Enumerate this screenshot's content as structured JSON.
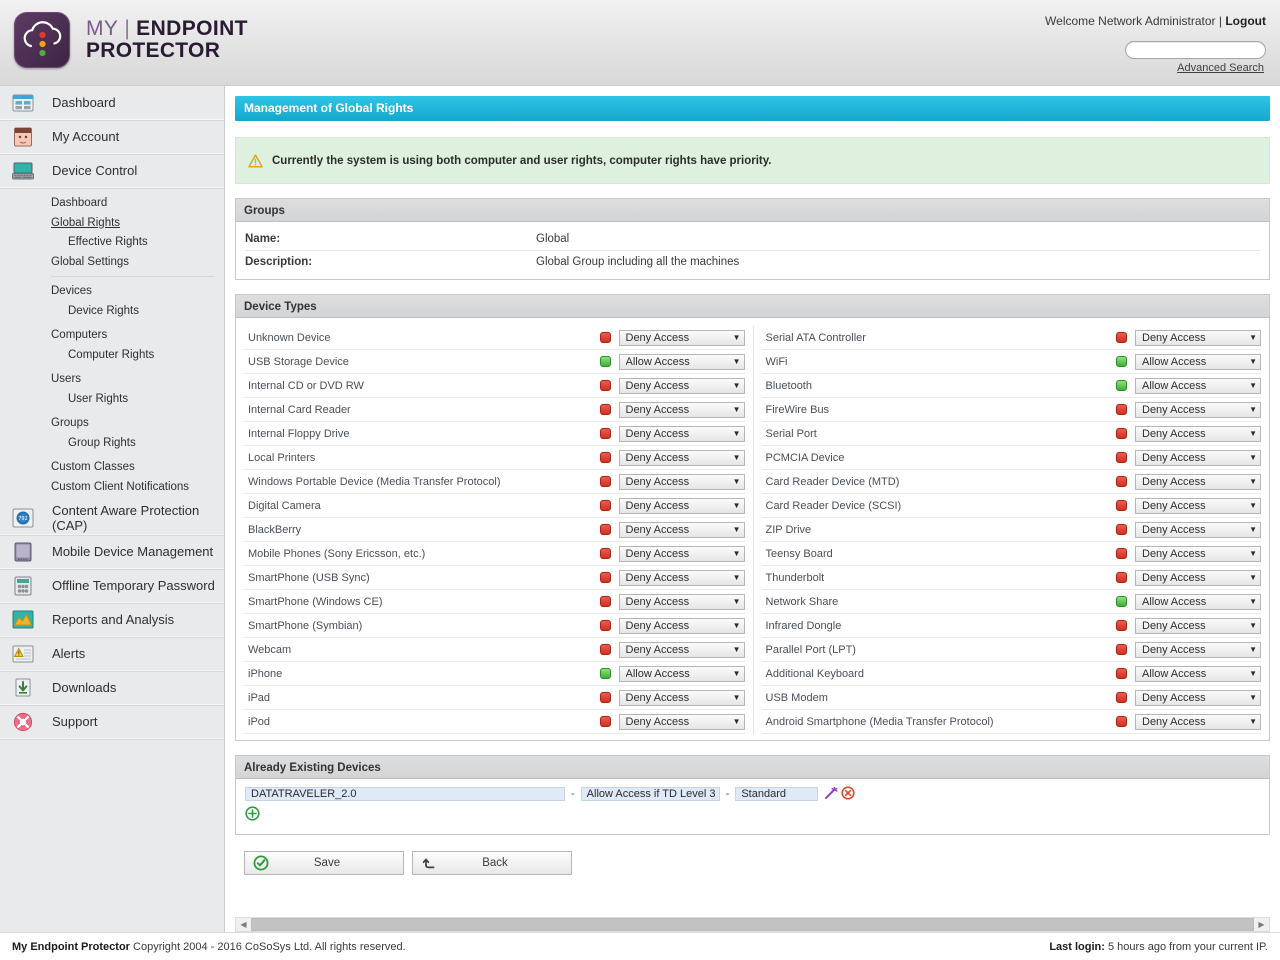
{
  "brand": {
    "my": "MY",
    "divider": "|",
    "line1": "ENDPOINT",
    "line2": "PROTECTOR",
    "logo_colors": {
      "badge": "#4b2e52",
      "red": "#e03b2e",
      "amber": "#f0a020",
      "green": "#4fae3a"
    }
  },
  "header": {
    "welcome": "Welcome Network Administrator",
    "separator": "|",
    "logout": "Logout",
    "search_placeholder": "",
    "search_value": "",
    "advanced_search": "Advanced Search"
  },
  "sidebar": {
    "items": [
      {
        "label": "Dashboard",
        "icon": "dashboard-icon"
      },
      {
        "label": "My Account",
        "icon": "user-icon"
      },
      {
        "label": "Device Control",
        "icon": "laptop-icon"
      },
      {
        "label": "Content Aware Protection (CAP)",
        "icon": "shield-icon"
      },
      {
        "label": "Mobile Device Management",
        "icon": "tablet-icon"
      },
      {
        "label": "Offline Temporary Password",
        "icon": "keypad-icon"
      },
      {
        "label": "Reports and Analysis",
        "icon": "chart-icon"
      },
      {
        "label": "Alerts",
        "icon": "alert-icon"
      },
      {
        "label": "Downloads",
        "icon": "download-icon"
      },
      {
        "label": "Support",
        "icon": "lifebuoy-icon"
      }
    ],
    "device_control_sub": [
      {
        "label": "Dashboard",
        "level": 1,
        "active": false
      },
      {
        "label": "Global Rights",
        "level": 1,
        "active": true
      },
      {
        "label": "Effective Rights",
        "level": 2,
        "active": false
      },
      {
        "label": "Global Settings",
        "level": 1,
        "active": false
      },
      {
        "label": "__SEP__",
        "level": 0,
        "active": false
      },
      {
        "label": "Devices",
        "level": 1,
        "active": false
      },
      {
        "label": "Device Rights",
        "level": 2,
        "active": false
      },
      {
        "label": "__GAP__",
        "level": 0,
        "active": false
      },
      {
        "label": "Computers",
        "level": 1,
        "active": false
      },
      {
        "label": "Computer Rights",
        "level": 2,
        "active": false
      },
      {
        "label": "__GAP__",
        "level": 0,
        "active": false
      },
      {
        "label": "Users",
        "level": 1,
        "active": false
      },
      {
        "label": "User Rights",
        "level": 2,
        "active": false
      },
      {
        "label": "__GAP__",
        "level": 0,
        "active": false
      },
      {
        "label": "Groups",
        "level": 1,
        "active": false
      },
      {
        "label": "Group Rights",
        "level": 2,
        "active": false
      },
      {
        "label": "__GAP__",
        "level": 0,
        "active": false
      },
      {
        "label": "Custom Classes",
        "level": 1,
        "active": false
      },
      {
        "label": "Custom Client Notifications",
        "level": 1,
        "active": false
      }
    ]
  },
  "page": {
    "title": "Management of Global Rights",
    "title_color": "#22b6da",
    "notice": "Currently the system is using both computer and user rights, computer rights have priority.",
    "notice_bg": "#ddf1de"
  },
  "groups_panel": {
    "heading": "Groups",
    "rows": [
      {
        "key": "Name:",
        "value": "Global"
      },
      {
        "key": "Description:",
        "value": "Global Group including all the machines"
      }
    ]
  },
  "device_types_panel": {
    "heading": "Device Types",
    "left": [
      {
        "name": "Unknown Device",
        "status": "deny",
        "right": "Deny Access"
      },
      {
        "name": "USB Storage Device",
        "status": "allow",
        "right": "Allow Access"
      },
      {
        "name": "Internal CD or DVD RW",
        "status": "deny",
        "right": "Deny Access"
      },
      {
        "name": "Internal Card Reader",
        "status": "deny",
        "right": "Deny Access"
      },
      {
        "name": "Internal Floppy Drive",
        "status": "deny",
        "right": "Deny Access"
      },
      {
        "name": "Local Printers",
        "status": "deny",
        "right": "Deny Access"
      },
      {
        "name": "Windows Portable Device (Media Transfer Protocol)",
        "status": "deny",
        "right": "Deny Access"
      },
      {
        "name": "Digital Camera",
        "status": "deny",
        "right": "Deny Access"
      },
      {
        "name": "BlackBerry",
        "status": "deny",
        "right": "Deny Access"
      },
      {
        "name": "Mobile Phones (Sony Ericsson, etc.)",
        "status": "deny",
        "right": "Deny Access"
      },
      {
        "name": "SmartPhone (USB Sync)",
        "status": "deny",
        "right": "Deny Access"
      },
      {
        "name": "SmartPhone (Windows CE)",
        "status": "deny",
        "right": "Deny Access"
      },
      {
        "name": "SmartPhone (Symbian)",
        "status": "deny",
        "right": "Deny Access"
      },
      {
        "name": "Webcam",
        "status": "deny",
        "right": "Deny Access"
      },
      {
        "name": "iPhone",
        "status": "allow",
        "right": "Allow Access"
      },
      {
        "name": "iPad",
        "status": "deny",
        "right": "Deny Access"
      },
      {
        "name": "iPod",
        "status": "deny",
        "right": "Deny Access"
      }
    ],
    "right": [
      {
        "name": "Serial ATA Controller",
        "status": "deny",
        "right": "Deny Access"
      },
      {
        "name": "WiFi",
        "status": "allow",
        "right": "Allow Access"
      },
      {
        "name": "Bluetooth",
        "status": "allow",
        "right": "Allow Access"
      },
      {
        "name": "FireWire Bus",
        "status": "deny",
        "right": "Deny Access"
      },
      {
        "name": "Serial Port",
        "status": "deny",
        "right": "Deny Access"
      },
      {
        "name": "PCMCIA Device",
        "status": "deny",
        "right": "Deny Access"
      },
      {
        "name": "Card Reader Device (MTD)",
        "status": "deny",
        "right": "Deny Access"
      },
      {
        "name": "Card Reader Device (SCSI)",
        "status": "deny",
        "right": "Deny Access"
      },
      {
        "name": "ZIP Drive",
        "status": "deny",
        "right": "Deny Access"
      },
      {
        "name": "Teensy Board",
        "status": "deny",
        "right": "Deny Access"
      },
      {
        "name": "Thunderbolt",
        "status": "deny",
        "right": "Deny Access"
      },
      {
        "name": "Network Share",
        "status": "allow",
        "right": "Allow Access"
      },
      {
        "name": "Infrared Dongle",
        "status": "deny",
        "right": "Deny Access"
      },
      {
        "name": "Parallel Port (LPT)",
        "status": "deny",
        "right": "Deny Access"
      },
      {
        "name": "Additional Keyboard",
        "status": "deny",
        "right": "Allow Access"
      },
      {
        "name": "USB Modem",
        "status": "deny",
        "right": "Deny Access"
      },
      {
        "name": "Android Smartphone (Media Transfer Protocol)",
        "status": "deny",
        "right": "Deny Access"
      }
    ],
    "status_colors": {
      "deny": "#d8382b",
      "allow": "#49b03c"
    }
  },
  "existing_devices_panel": {
    "heading": "Already Existing Devices",
    "rows": [
      {
        "device": "DATATRAVELER_2.0",
        "separator": "-",
        "right": "Allow Access if TD Level 3",
        "policy": "Standard",
        "icons": [
          "wand-icon",
          "delete-icon"
        ]
      }
    ],
    "add_icon": "add-circle-icon"
  },
  "actions": {
    "save": "Save",
    "back": "Back"
  },
  "scrollbar": {
    "left_arrow": "◀",
    "right_arrow": "▶"
  },
  "footer": {
    "brand": "My Endpoint Protector",
    "copyright": "Copyright 2004 - 2016 CoSoSys Ltd. All rights reserved.",
    "last_login_label": "Last login:",
    "last_login_value": "5 hours ago from your current IP."
  }
}
